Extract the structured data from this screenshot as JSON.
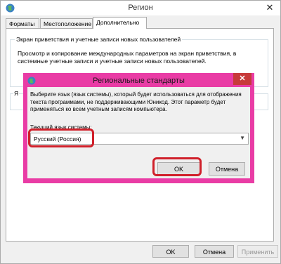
{
  "window": {
    "title": "Регион",
    "close_glyph": "✕"
  },
  "tabs": [
    {
      "label": "Форматы"
    },
    {
      "label": "Местоположение"
    },
    {
      "label": "Дополнительно"
    }
  ],
  "panel": {
    "welcome_group_title": "Экран приветствия и учетные записи новых пользователей",
    "welcome_group_text": "Просмотр и копирование международных параметров на экран приветствия, в системные учетные записи и учетные записи новых пользователей.",
    "partial_group_label": "Я"
  },
  "footer": {
    "ok": "OK",
    "cancel": "Отмена",
    "apply": "Применить"
  },
  "dialog": {
    "title": "Региональные стандарты",
    "close_glyph": "✕",
    "description": "Выберите язык (язык системы), который будет использоваться для отображения текста программами, не поддерживающими Юникод. Этот параметр будет применяться ко всем учетным записям компьютера.",
    "current_label": "Текущий язык системы:",
    "selected_language": "Русский (Россия)",
    "ok": "OK",
    "cancel": "Отмена"
  },
  "colors": {
    "dialog_frame": "#e93ca5",
    "dialog_close": "#c73a3a",
    "highlight_ring": "#d0202a"
  }
}
